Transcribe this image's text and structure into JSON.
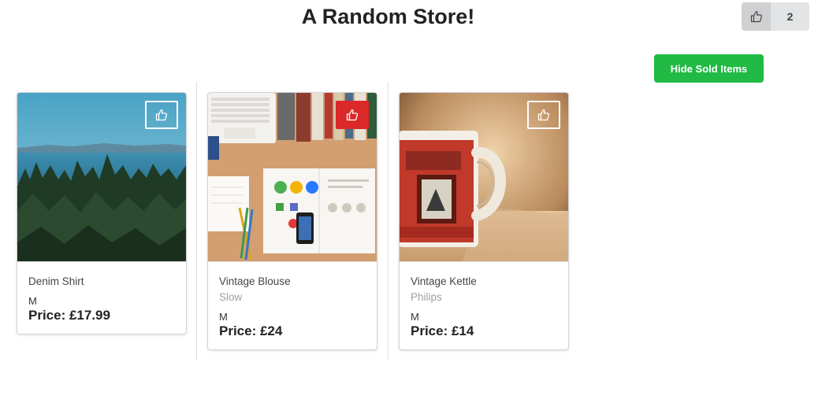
{
  "header": {
    "title": "A Random Store!",
    "likes_count": "2"
  },
  "toolbar": {
    "hide_sold_label": "Hide Sold Items"
  },
  "products": [
    {
      "name": "Denim Shirt",
      "brand": "",
      "size": "M",
      "price": "Price: £17.99",
      "liked": false,
      "image": "forest-lake-photo"
    },
    {
      "name": "Vintage Blouse",
      "brand": "Slow",
      "size": "M",
      "price": "Price: £24",
      "liked": true,
      "image": "desk-flatlay-photo"
    },
    {
      "name": "Vintage Kettle",
      "brand": "Philips",
      "size": "M",
      "price": "Price: £14",
      "liked": false,
      "image": "mug-photo"
    }
  ],
  "colors": {
    "accent_green": "#21ba45",
    "liked_red": "#db2828",
    "counter_bg": "#e3e4e6"
  },
  "icons": {
    "like": "thumbs-up-icon"
  }
}
